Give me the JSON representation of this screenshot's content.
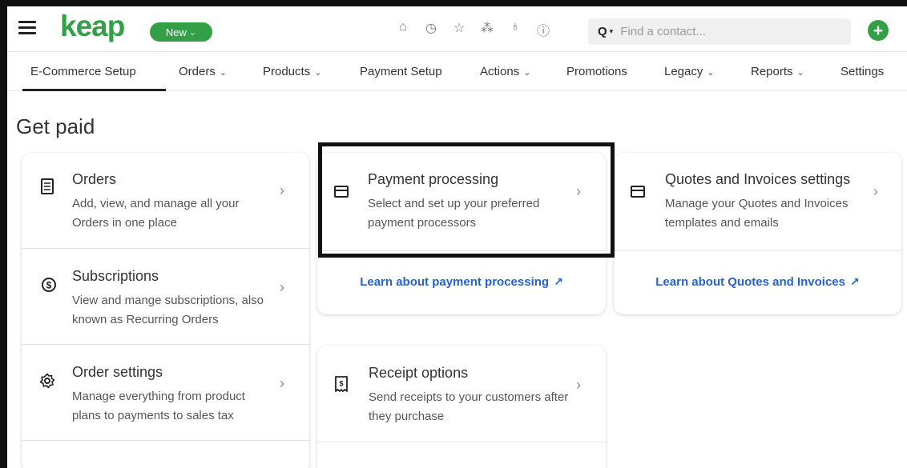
{
  "app": {
    "logo": "keap",
    "new_button": "New",
    "new_caret": "⌄"
  },
  "top_icons": [
    {
      "name": "home-icon",
      "glyph": "⌂"
    },
    {
      "name": "clock-icon",
      "glyph": "◷"
    },
    {
      "name": "star-icon",
      "glyph": "☆"
    },
    {
      "name": "broadcast-icon",
      "glyph": "⁂"
    },
    {
      "name": "user-icon",
      "glyph": "♁"
    },
    {
      "name": "help-icon",
      "glyph": "ⓘ"
    }
  ],
  "search": {
    "placeholder": "Find a contact...",
    "icon": "Q",
    "caret": "▾"
  },
  "add_button": "+",
  "nav": {
    "items": [
      {
        "label": "E-Commerce Setup",
        "dropdown": false,
        "active": true
      },
      {
        "label": "Orders",
        "dropdown": true
      },
      {
        "label": "Products",
        "dropdown": true
      },
      {
        "label": "Payment Setup",
        "dropdown": false
      },
      {
        "label": "Actions",
        "dropdown": true
      },
      {
        "label": "Promotions",
        "dropdown": false
      },
      {
        "label": "Legacy",
        "dropdown": true
      },
      {
        "label": "Reports",
        "dropdown": true
      },
      {
        "label": "Settings",
        "dropdown": false
      }
    ],
    "chevron": "⌄"
  },
  "page": {
    "title": "Get paid"
  },
  "cards": {
    "left": [
      {
        "title": "Orders",
        "desc": "Add, view, and manage all your Orders in one place",
        "icon": "receipt-list-icon"
      },
      {
        "title": "Subscriptions",
        "desc": "View and mange subscriptions, also known as Recurring Orders",
        "icon": "subscription-dollar-icon"
      },
      {
        "title": "Order settings",
        "desc": "Manage everything from product plans to payments to sales tax",
        "icon": "gear-icon"
      }
    ],
    "payment": {
      "title": "Payment processing",
      "desc": "Select and set up your preferred payment processors",
      "learn": "Learn about payment processing"
    },
    "quotes": {
      "title": "Quotes and Invoices settings",
      "desc": "Manage your Quotes and Invoices templates and emails",
      "learn": "Learn about Quotes and Invoices"
    },
    "receipt": {
      "title": "Receipt options",
      "desc": "Send receipts to your customers after they purchase"
    }
  },
  "chevron_right": "›",
  "external_glyph": "↗"
}
